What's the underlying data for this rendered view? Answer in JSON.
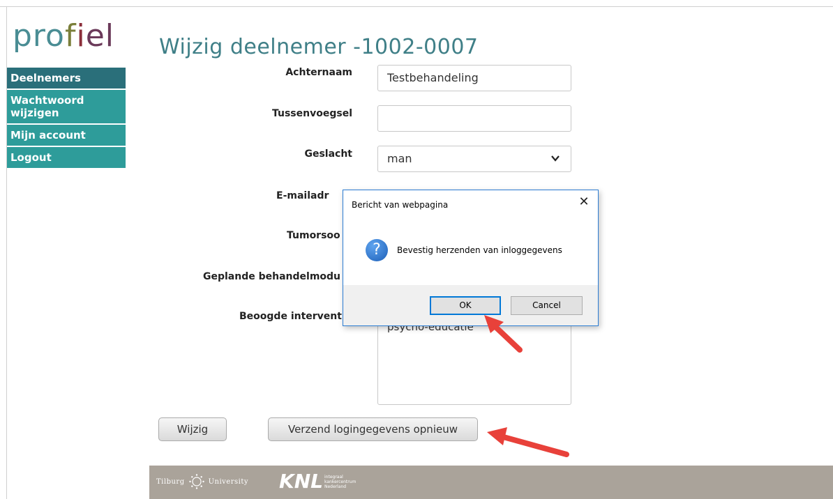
{
  "logo": {
    "part1": "pro",
    "part2": "f",
    "part3": "i",
    "part4": "el"
  },
  "nav": {
    "items": [
      {
        "label": "Deelnemers",
        "active": true
      },
      {
        "label": "Wachtwoord wijzigen"
      },
      {
        "label": "Mijn account"
      },
      {
        "label": "Logout"
      }
    ]
  },
  "page": {
    "title": "Wijzig deelnemer -1002-0007"
  },
  "form": {
    "achternaam_label": "Achternaam",
    "achternaam_value": "Testbehandeling",
    "tussenvoegsel_label": "Tussenvoegsel",
    "tussenvoegsel_value": "",
    "geslacht_label": "Geslacht",
    "geslacht_value": "man",
    "email_label": "E-mailadr",
    "tumor_label": "Tumorsoo",
    "module_label": "Geplande behandelmodu",
    "interventie_label": "Beoogde intervent",
    "interventie_value": "psycho-educatie"
  },
  "buttons": {
    "wijzig": "Wijzig",
    "verzend": "Verzend logingegevens opnieuw"
  },
  "dialog": {
    "title": "Bericht van webpagina",
    "message": "Bevestig herzenden van inloggegevens",
    "icon": "?",
    "ok": "OK",
    "cancel": "Cancel"
  },
  "footer": {
    "tilburg_left": "Tilburg",
    "tilburg_right": "University",
    "knl": "KNL",
    "knl_line1": "integraal",
    "knl_line2": "kankercentrum",
    "knl_line3": "Nederland"
  },
  "colors": {
    "nav_bg": "#2e9c9a",
    "nav_active": "#2a6f7a",
    "title": "#3f7f87",
    "arrow": "#e8413a",
    "footer_bg": "#aaa39a"
  }
}
